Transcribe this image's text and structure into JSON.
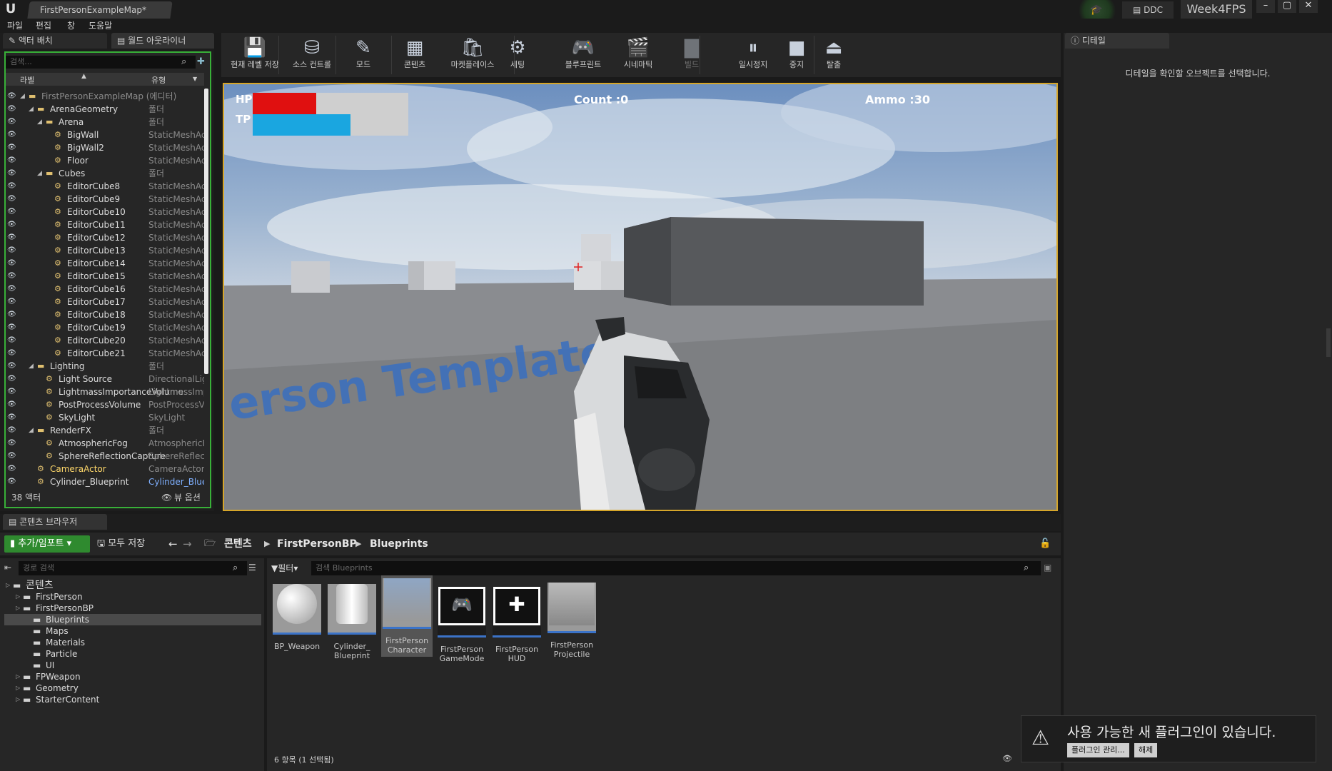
{
  "titlebar": {
    "document_tab": "FirstPersonExampleMap*",
    "ddc_label": "DDC",
    "project_name": "Week4FPS",
    "win_minimize": "–",
    "win_restore": "▢",
    "win_close": "✕"
  },
  "menu": [
    "파일",
    "편집",
    "창",
    "도움말"
  ],
  "left_tabs": {
    "tab1": "액터 배치",
    "tab2": "월드 아웃라이너"
  },
  "outliner": {
    "search_placeholder": "검색...",
    "col_label": "라벨",
    "col_type": "유형",
    "rows": [
      {
        "label": "FirstPersonExampleMap (에디터)",
        "type": "",
        "indent": 0
      },
      {
        "label": "ArenaGeometry",
        "type": "폴더",
        "indent": 1
      },
      {
        "label": "Arena",
        "type": "폴더",
        "indent": 2
      },
      {
        "label": "BigWall",
        "type": "StaticMeshActor",
        "indent": 3
      },
      {
        "label": "BigWall2",
        "type": "StaticMeshActor",
        "indent": 3
      },
      {
        "label": "Floor",
        "type": "StaticMeshActor",
        "indent": 3
      },
      {
        "label": "Cubes",
        "type": "폴더",
        "indent": 2
      },
      {
        "label": "EditorCube8",
        "type": "StaticMeshActor",
        "indent": 3
      },
      {
        "label": "EditorCube9",
        "type": "StaticMeshActor",
        "indent": 3
      },
      {
        "label": "EditorCube10",
        "type": "StaticMeshActor",
        "indent": 3
      },
      {
        "label": "EditorCube11",
        "type": "StaticMeshActor",
        "indent": 3
      },
      {
        "label": "EditorCube12",
        "type": "StaticMeshActor",
        "indent": 3
      },
      {
        "label": "EditorCube13",
        "type": "StaticMeshActor",
        "indent": 3
      },
      {
        "label": "EditorCube14",
        "type": "StaticMeshActor",
        "indent": 3
      },
      {
        "label": "EditorCube15",
        "type": "StaticMeshActor",
        "indent": 3
      },
      {
        "label": "EditorCube16",
        "type": "StaticMeshActor",
        "indent": 3
      },
      {
        "label": "EditorCube17",
        "type": "StaticMeshActor",
        "indent": 3
      },
      {
        "label": "EditorCube18",
        "type": "StaticMeshActor",
        "indent": 3
      },
      {
        "label": "EditorCube19",
        "type": "StaticMeshActor",
        "indent": 3
      },
      {
        "label": "EditorCube20",
        "type": "StaticMeshActor",
        "indent": 3
      },
      {
        "label": "EditorCube21",
        "type": "StaticMeshActor",
        "indent": 3
      },
      {
        "label": "Lighting",
        "type": "폴더",
        "indent": 1
      },
      {
        "label": "Light Source",
        "type": "DirectionalLight",
        "indent": 2
      },
      {
        "label": "LightmassImportanceVolume",
        "type": "LightmassImportanceVolume",
        "indent": 2
      },
      {
        "label": "PostProcessVolume",
        "type": "PostProcessVolume",
        "indent": 2
      },
      {
        "label": "SkyLight",
        "type": "SkyLight",
        "indent": 2
      },
      {
        "label": "RenderFX",
        "type": "폴더",
        "indent": 1
      },
      {
        "label": "AtmosphericFog",
        "type": "AtmosphericFog",
        "indent": 2
      },
      {
        "label": "SphereReflectionCapture",
        "type": "SphereReflectionCapture",
        "indent": 2
      },
      {
        "label": "CameraActor",
        "type": "CameraActor",
        "indent": 1
      },
      {
        "label": "Cylinder_Blueprint",
        "type": "Cylinder_Blueprint",
        "indent": 1
      }
    ],
    "actor_count": "38 액터",
    "view_options": "뷰 옵션"
  },
  "toolbar": [
    {
      "label": "현재 레벨 저장",
      "icon": "save-icon"
    },
    {
      "label": "소스 컨트롤",
      "icon": "source-control-icon"
    },
    {
      "label": "모드",
      "icon": "modes-icon"
    },
    {
      "label": "콘텐츠",
      "icon": "content-icon"
    },
    {
      "label": "마켓플레이스",
      "icon": "marketplace-icon"
    },
    {
      "label": "세팅",
      "icon": "settings-icon"
    },
    {
      "label": "블루프린트",
      "icon": "blueprint-icon"
    },
    {
      "label": "시네마틱",
      "icon": "cinematics-icon"
    },
    {
      "label": "빌드",
      "icon": "build-icon"
    },
    {
      "label": "일시정지",
      "icon": "pause-icon"
    },
    {
      "label": "중지",
      "icon": "stop-icon"
    },
    {
      "label": "탈출",
      "icon": "eject-icon"
    }
  ],
  "hud": {
    "hp_label": "HP",
    "tp_label": "TP",
    "hp_fraction": 0.41,
    "tp_fraction": 0.63,
    "count": "Count :0",
    "ammo": "Ammo :30",
    "floor_text": "erson Template",
    "hp_color": "#e01010",
    "tp_color": "#1aa6e0"
  },
  "details": {
    "tab": "디테일",
    "message": "디테일을 확인할 오브젝트를 선택합니다."
  },
  "content_browser": {
    "tab": "콘텐츠 브라우저",
    "add_import": "추가/임포트",
    "save_all": "모두 저장",
    "breadcrumb": [
      "콘텐츠",
      "FirstPersonBP",
      "Blueprints"
    ],
    "path_search_placeholder": "경로 검색",
    "filter_label": "필터",
    "asset_search_placeholder": "검색 Blueprints",
    "tree": [
      {
        "label": "콘텐츠",
        "indent": 0
      },
      {
        "label": "FirstPerson",
        "indent": 1
      },
      {
        "label": "FirstPersonBP",
        "indent": 1
      },
      {
        "label": "Blueprints",
        "indent": 2
      },
      {
        "label": "Maps",
        "indent": 2
      },
      {
        "label": "Materials",
        "indent": 2
      },
      {
        "label": "Particle",
        "indent": 2
      },
      {
        "label": "UI",
        "indent": 2
      },
      {
        "label": "FPWeapon",
        "indent": 1
      },
      {
        "label": "Geometry",
        "indent": 1
      },
      {
        "label": "StarterContent",
        "indent": 1
      }
    ],
    "assets": [
      {
        "line1": "BP_Weapon",
        "line2": ""
      },
      {
        "line1": "Cylinder_",
        "line2": "Blueprint"
      },
      {
        "line1": "FirstPerson",
        "line2": "Character"
      },
      {
        "line1": "FirstPerson",
        "line2": "GameMode"
      },
      {
        "line1": "FirstPerson",
        "line2": "HUD"
      },
      {
        "line1": "FirstPerson",
        "line2": "Projectile"
      }
    ],
    "item_count": "6 항목 (1 선택됨)",
    "view_options": "뷰 옵션"
  },
  "notification": {
    "message": "사용 가능한 새 플러그인이 있습니다.",
    "manage_btn": "플러그인 관리...",
    "dismiss_btn": "해제"
  }
}
